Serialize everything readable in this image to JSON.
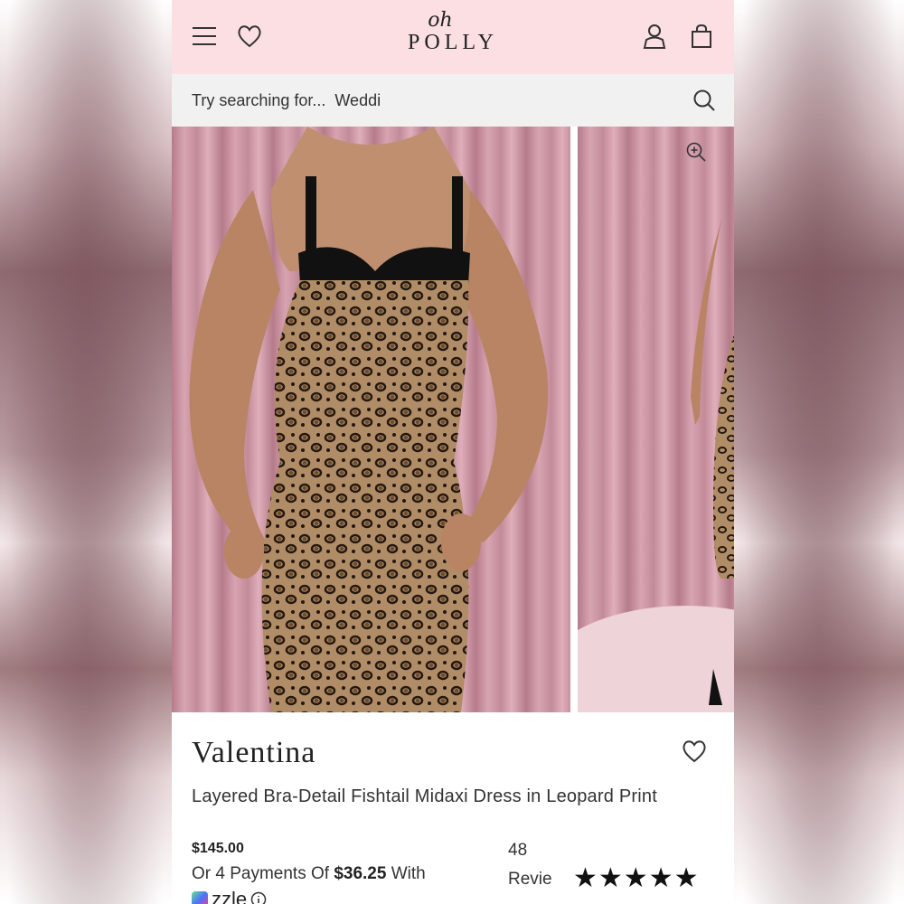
{
  "header": {
    "logo_top": "oh",
    "logo_bottom": "POLLY"
  },
  "search": {
    "label": "Try searching for...",
    "suggestion": "Weddi"
  },
  "product": {
    "brand": "Valentina",
    "title": "Layered Bra-Detail Fishtail Midaxi Dress in Leopard Print",
    "price": "$145.00",
    "payments_prefix": "Or 4 Payments Of ",
    "payments_amount": "$36.25",
    "payments_suffix": " With",
    "pay_provider": "zzle",
    "reviews_count": "48",
    "reviews_label": "Revie",
    "rating_stars": "★★★★★"
  },
  "colors": {
    "header_bg": "#fbdfe2",
    "search_bg": "#f1f1f1",
    "text": "#222222"
  },
  "icons": [
    "menu-icon",
    "heart-icon",
    "user-icon",
    "bag-icon",
    "search-icon",
    "zoom-in-icon",
    "wishlist-heart-icon",
    "info-icon"
  ]
}
